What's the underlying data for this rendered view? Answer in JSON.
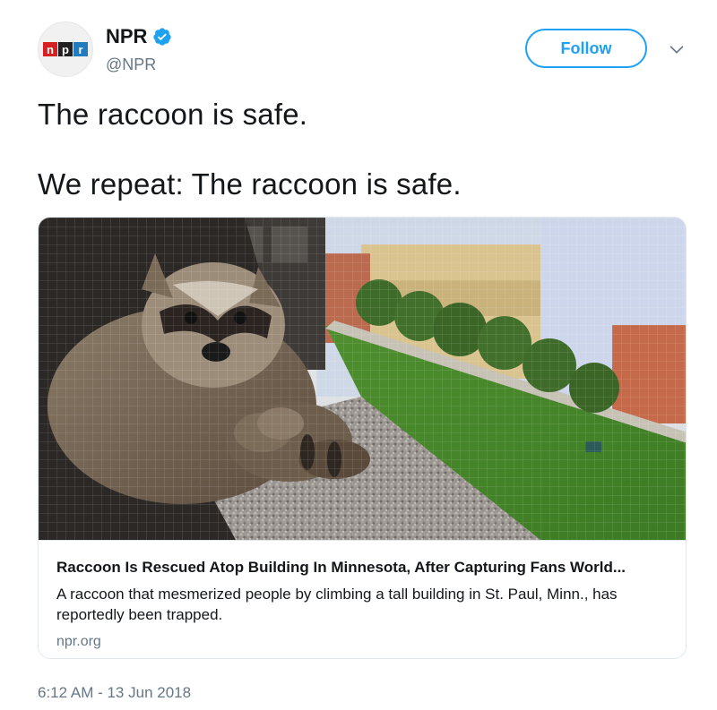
{
  "author": {
    "display_name": "NPR",
    "handle": "@NPR",
    "verified": true,
    "avatar_logo_letters": [
      "n",
      "p",
      "r"
    ]
  },
  "actions": {
    "follow_label": "Follow",
    "menu_icon": "chevron-down-icon"
  },
  "tweet": {
    "line1": "The raccoon is safe.",
    "line2": "We repeat: The raccoon is safe.",
    "timestamp": "6:12 AM - 13 Jun 2018"
  },
  "card": {
    "image_icon": "raccoon-photo",
    "title": "Raccoon Is Rescued Atop Building In Minnesota, After Capturing Fans World...",
    "description": "A raccoon that mesmerized people by climbing a tall building in St. Paul, Minn., has reportedly been trapped.",
    "domain": "npr.org"
  },
  "colors": {
    "accent": "#1da1f2",
    "npr_red": "#d62021",
    "npr_black": "#231f20",
    "npr_blue": "#237bbd",
    "secondary_text": "#657786"
  }
}
